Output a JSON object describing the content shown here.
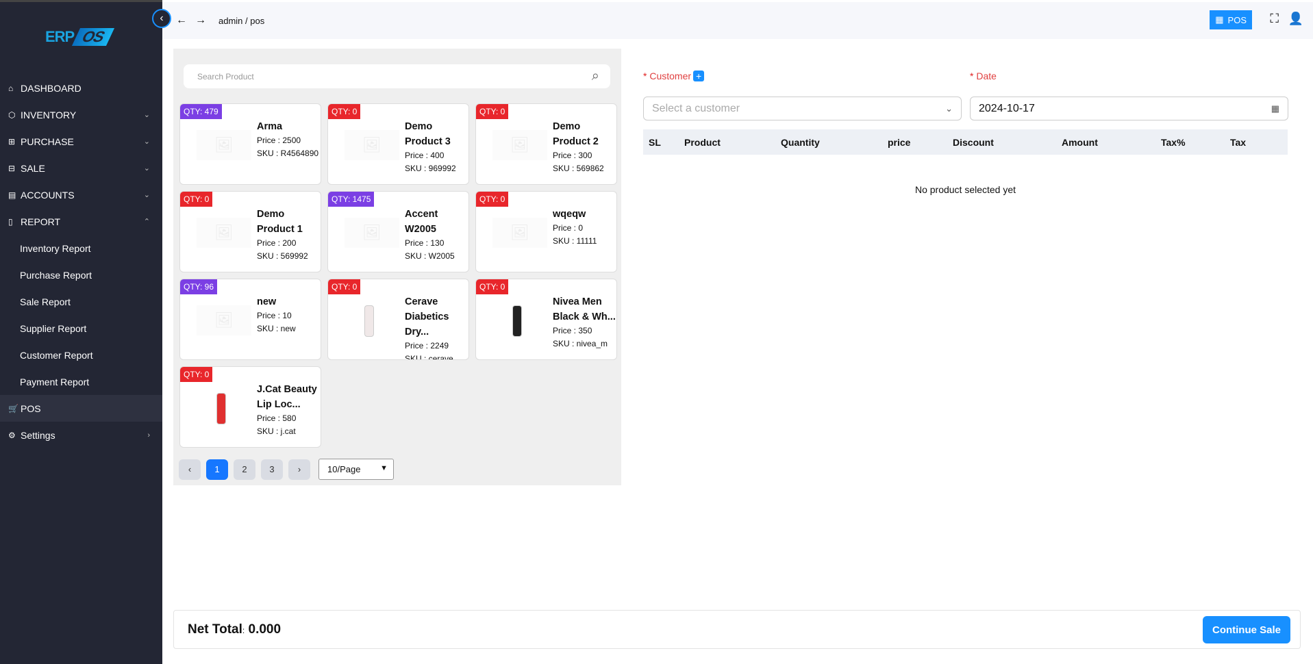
{
  "logo": {
    "erp": "ERP",
    "os": "OS"
  },
  "sidebar": [
    {
      "icon": "⌂",
      "iconName": "home-icon",
      "label": "DASHBOARD",
      "chev": ""
    },
    {
      "icon": "⬡",
      "iconName": "inventory-icon",
      "label": "INVENTORY",
      "chev": "⌄"
    },
    {
      "icon": "⊞",
      "iconName": "purchase-icon",
      "label": "PURCHASE",
      "chev": "⌄"
    },
    {
      "icon": "⊟",
      "iconName": "sale-icon",
      "label": "SALE",
      "chev": "⌄"
    },
    {
      "icon": "▤",
      "iconName": "accounts-icon",
      "label": "ACCOUNTS",
      "chev": "⌄"
    },
    {
      "icon": "▯",
      "iconName": "report-icon",
      "label": "REPORT",
      "chev": "⌃"
    }
  ],
  "report_sub": [
    "Inventory Report",
    "Purchase Report",
    "Sale Report",
    "Supplier Report",
    "Customer Report",
    "Payment Report"
  ],
  "sidebar_bottom": [
    {
      "icon": "🛒",
      "iconName": "cart-icon",
      "label": "POS",
      "chev": ""
    },
    {
      "icon": "⚙",
      "iconName": "gear-icon",
      "label": "Settings",
      "chev": "›"
    }
  ],
  "header": {
    "crumb": "admin  / pos",
    "pos_label": "POS"
  },
  "search": {
    "placeholder": "Search Product"
  },
  "colors": {
    "qty_positive": "#7b3fe4",
    "qty_zero": "#e8262b"
  },
  "products": [
    {
      "qty": "QTY: 479",
      "in": true,
      "name": "Arma",
      "price": "Price : 2500",
      "sku": "SKU : R4564890",
      "img": "placeholder"
    },
    {
      "qty": "QTY: 0",
      "in": false,
      "name": "Demo Product 3",
      "price": "Price : 400",
      "sku": "SKU : 969992",
      "img": "placeholder"
    },
    {
      "qty": "QTY: 0",
      "in": false,
      "name": "Demo Product 2",
      "price": "Price : 300",
      "sku": "SKU : 569862",
      "img": "placeholder"
    },
    {
      "qty": "QTY: 0",
      "in": false,
      "name": "Demo Product 1",
      "price": "Price : 200",
      "sku": "SKU : 569992",
      "img": "placeholder"
    },
    {
      "qty": "QTY: 1475",
      "in": true,
      "name": "Accent W2005",
      "price": "Price : 130",
      "sku": "SKU : W2005",
      "img": "placeholder"
    },
    {
      "qty": "QTY: 0",
      "in": false,
      "name": "wqeqw",
      "price": "Price : 0",
      "sku": "SKU : 11111",
      "img": "placeholder"
    },
    {
      "qty": "QTY: 96",
      "in": true,
      "name": "new",
      "price": "Price : 10",
      "sku": "SKU : new",
      "img": "placeholder"
    },
    {
      "qty": "QTY: 0",
      "in": false,
      "name": "Cerave Diabetics Dry...",
      "price": "Price : 2249",
      "sku": "SKU : cerave_",
      "img": "#f0e8e8"
    },
    {
      "qty": "QTY: 0",
      "in": false,
      "name": "Nivea Men Black & Wh...",
      "price": "Price : 350",
      "sku": "SKU : nivea_m",
      "img": "#222"
    },
    {
      "qty": "QTY: 0",
      "in": false,
      "name": "J.Cat Beauty Lip Loc...",
      "price": "Price : 580",
      "sku": "SKU : j.cat",
      "img": "#e03030"
    }
  ],
  "pagination": {
    "pages": [
      "1",
      "2",
      "3"
    ],
    "current": "1",
    "page_size": "10/Page"
  },
  "form": {
    "customer_label": "Customer",
    "date_label": "Date",
    "required": "* ",
    "customer_placeholder": "Select a customer",
    "date_value": "2024-10-17"
  },
  "table": {
    "columns": [
      "SL",
      "Product",
      "Quantity",
      "price",
      "Discount",
      "Amount",
      "Tax%",
      "Tax"
    ],
    "empty": "No product selected yet"
  },
  "footer": {
    "net_label": "Net Total",
    "colon": ":",
    "net_value": "0.000",
    "continue": "Continue Sale"
  }
}
